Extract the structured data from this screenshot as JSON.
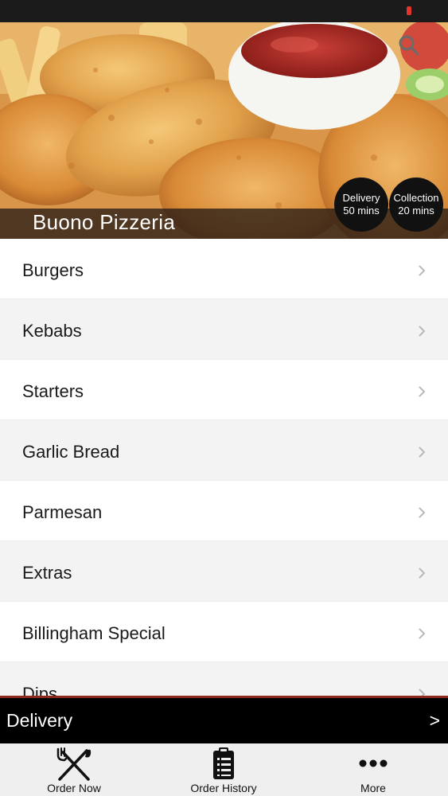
{
  "hero": {
    "restaurant_name": "Buono Pizzeria",
    "delivery_badge": {
      "label": "Delivery",
      "time": "50 mins"
    },
    "collection_badge": {
      "label": "Collection",
      "time": "20 mins"
    },
    "search_icon": "search-icon"
  },
  "categories": [
    {
      "label": "Burgers"
    },
    {
      "label": "Kebabs"
    },
    {
      "label": "Starters"
    },
    {
      "label": "Garlic Bread"
    },
    {
      "label": "Parmesan"
    },
    {
      "label": "Extras"
    },
    {
      "label": "Billingham Special"
    },
    {
      "label": "Dips"
    }
  ],
  "order_type_bar": {
    "label": "Delivery",
    "arrow": ">"
  },
  "tabs": [
    {
      "label": "Order Now",
      "icon": "fork-knife-icon"
    },
    {
      "label": "Order History",
      "icon": "clipboard-list-icon"
    },
    {
      "label": "More",
      "icon": "more-dots-icon"
    }
  ],
  "colors": {
    "status_bar": "#1b1b1b",
    "accent_border": "#8a2a1c",
    "order_bar_bg": "#000000",
    "tab_bar_bg": "#efefef"
  }
}
